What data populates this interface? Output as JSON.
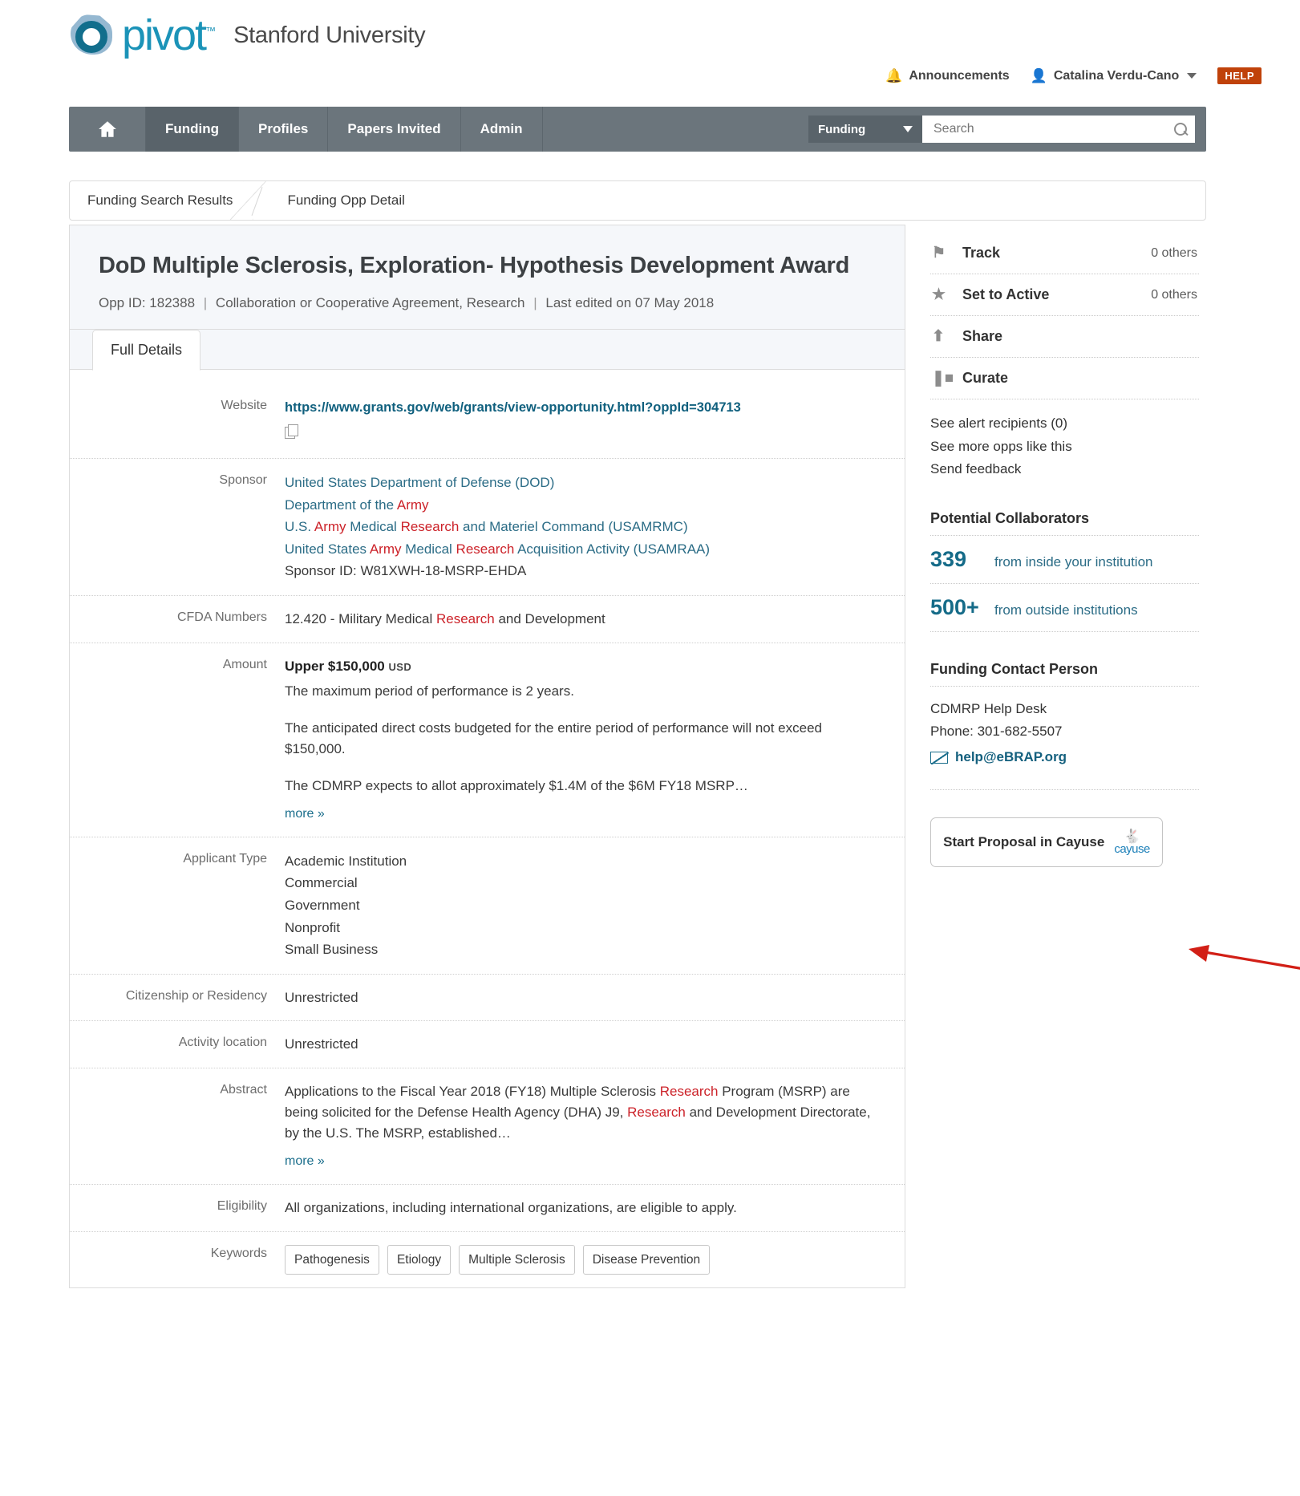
{
  "brand": {
    "name": "pivot",
    "tm": "™",
    "institution": "Stanford University"
  },
  "utility": {
    "announcements": "Announcements",
    "announcements_icon": "bell-icon",
    "user": "Catalina Verdu-Cano",
    "user_icon": "user-icon",
    "help": "HELP"
  },
  "nav": {
    "home_icon": "home-icon",
    "tabs": [
      {
        "label": "Funding",
        "active": true
      },
      {
        "label": "Profiles",
        "active": false
      },
      {
        "label": "Papers Invited",
        "active": false
      },
      {
        "label": "Admin",
        "active": false
      }
    ],
    "search": {
      "scope": "Funding",
      "placeholder": "Search",
      "value": "",
      "icon": "search-icon"
    }
  },
  "breadcrumb": {
    "first": "Funding Search Results",
    "current": "Funding Opp Detail"
  },
  "opportunity": {
    "title": "DoD Multiple Sclerosis, Exploration- Hypothesis Development Award",
    "opp_id_label": "Opp ID: 182388",
    "type": "Collaboration or Cooperative Agreement, Research",
    "last_edited": "Last edited on 07 May 2018",
    "tab": "Full Details"
  },
  "details": {
    "website_label": "Website",
    "website_url": "https://www.grants.gov/web/grants/view-opportunity.html?oppId=304713",
    "copy_icon": "copy-icon",
    "sponsor_label": "Sponsor",
    "sponsor_lines": [
      "United States Department of Defense (DOD)",
      "Department of the Army",
      "U.S. Army Medical Research and Materiel Command (USAMRMC)",
      "United States Army Medical Research Acquisition Activity (USAMRAA)"
    ],
    "sponsor_id": "Sponsor ID: W81XWH-18-MSRP-EHDA",
    "cfda_label": "CFDA Numbers",
    "cfda_value": "12.420 - Military Medical Research and Development",
    "amount_label": "Amount",
    "amount_upper_label": "Upper",
    "amount_value": "$150,000",
    "amount_currency": "USD",
    "amount_p1": "The maximum period of performance is 2 years.",
    "amount_p2": "The anticipated direct costs budgeted for the entire period of performance will not exceed $150,000.",
    "amount_p3": "The CDMRP expects to allot approximately $1.4M of the $6M FY18 MSRP…",
    "amount_more": "more »",
    "applicant_label": "Applicant Type",
    "applicant_types": [
      "Academic Institution",
      "Commercial",
      "Government",
      "Nonprofit",
      "Small Business"
    ],
    "citizenship_label": "Citizenship or Residency",
    "citizenship_value": "Unrestricted",
    "activity_label": "Activity location",
    "activity_value": "Unrestricted",
    "abstract_label": "Abstract",
    "abstract_text": "Applications to the Fiscal Year 2018 (FY18) Multiple Sclerosis Research Program (MSRP) are being solicited for the Defense Health Agency (DHA) J9, Research and Development Directorate, by the U.S. The MSRP, established…",
    "abstract_more": "more »",
    "eligibility_label": "Eligibility",
    "eligibility_value": "All organizations, including international organizations, are eligible to apply.",
    "keywords_label": "Keywords",
    "keywords": [
      "Pathogenesis",
      "Etiology",
      "Multiple Sclerosis",
      "Disease Prevention"
    ]
  },
  "sidebar": {
    "actions": [
      {
        "label": "Track",
        "count": "0 others",
        "icon": "flag-icon"
      },
      {
        "label": "Set to Active",
        "count": "0 others",
        "icon": "star-icon"
      },
      {
        "label": "Share",
        "count": "",
        "icon": "share-icon"
      },
      {
        "label": "Curate",
        "count": "",
        "icon": "copy-stack-icon"
      }
    ],
    "links": [
      "See alert recipients  (0)",
      "See more opps like this",
      "Send feedback"
    ],
    "collaborators_title": "Potential Collaborators",
    "collaborators": [
      {
        "count": "339",
        "text": "from inside your institution"
      },
      {
        "count": "500+",
        "text": "from outside institutions"
      }
    ],
    "contact_title": "Funding Contact Person",
    "contact_name": "CDMRP Help Desk",
    "contact_phone": "Phone: 301-682-5507",
    "contact_email": "help@eBRAP.org",
    "email_icon": "envelope-icon",
    "cayuse_button": "Start Proposal in Cayuse",
    "cayuse_brand": "cayuse"
  },
  "annotation": {
    "arrow": "red-arrow-pointing-left",
    "color": "#d21f16"
  },
  "colors": {
    "accent": "#1b93b8",
    "link": "#10607e",
    "highlight": "#cc2229",
    "nav": "#6b757c",
    "help": "#c0420a"
  }
}
